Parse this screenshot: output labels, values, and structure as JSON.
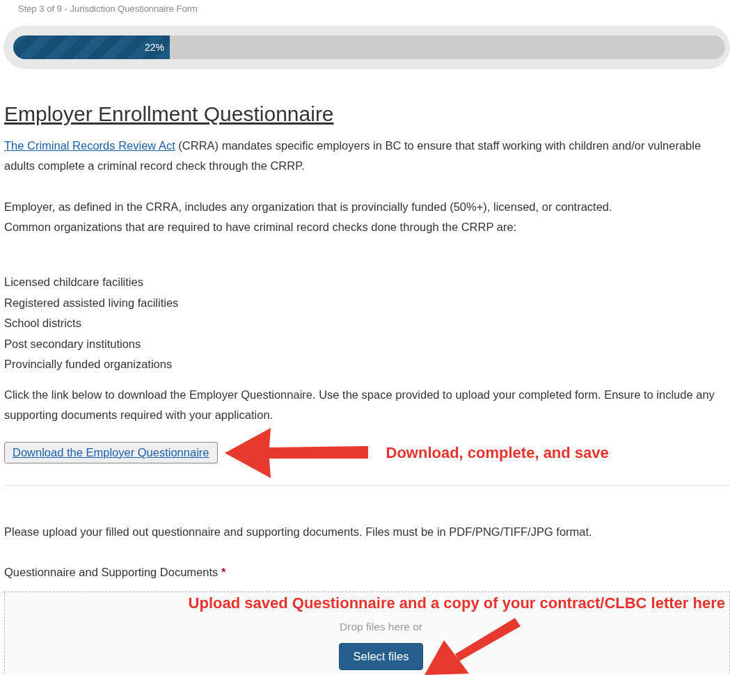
{
  "step_label": "Step 3 of 9 - Jurisdiction Questionnaire Form",
  "progress": {
    "level": 0.22,
    "reading": "22%"
  },
  "title": "Employer Enrollment Questionnaire",
  "intro": {
    "link": "The Criminal Records Review Act",
    "text": " (CRRA) mandates specific employers in BC to ensure that staff working with children and/or vulnerable adults complete a criminal record check through the CRRP."
  },
  "paragraphs": [
    "Employer, as defined in the CRRA, includes any organization that is provincially funded (50%+), licensed, or contracted.",
    "Common organizations that are required to have criminal record checks done through the CRRP are:"
  ],
  "organizations": [
    "Licensed childcare facilities",
    "Registered assisted living facilities",
    "School districts",
    "Post secondary institutions",
    "Provincially funded organizations"
  ],
  "download_instructions": "Click the link below to download the Employer Questionnaire. Use the space provided to upload your completed form. Ensure to include any supporting documents required with your application.",
  "download_button": "Download the Employer Questionnaire",
  "download_annotation": "Download, complete, and save",
  "upload_instructions": "Please upload your filled out questionnaire and supporting documents. Files must be in PDF/PNG/TIFF/JPG format.",
  "upload_field": {
    "label": "Questionnaire and Supporting Documents",
    "required_marker": "*",
    "annotation": "Upload saved Questionnaire and a copy of your contract/CLBC letter here",
    "drop_text": "Drop files here or",
    "button": "Select files"
  }
}
